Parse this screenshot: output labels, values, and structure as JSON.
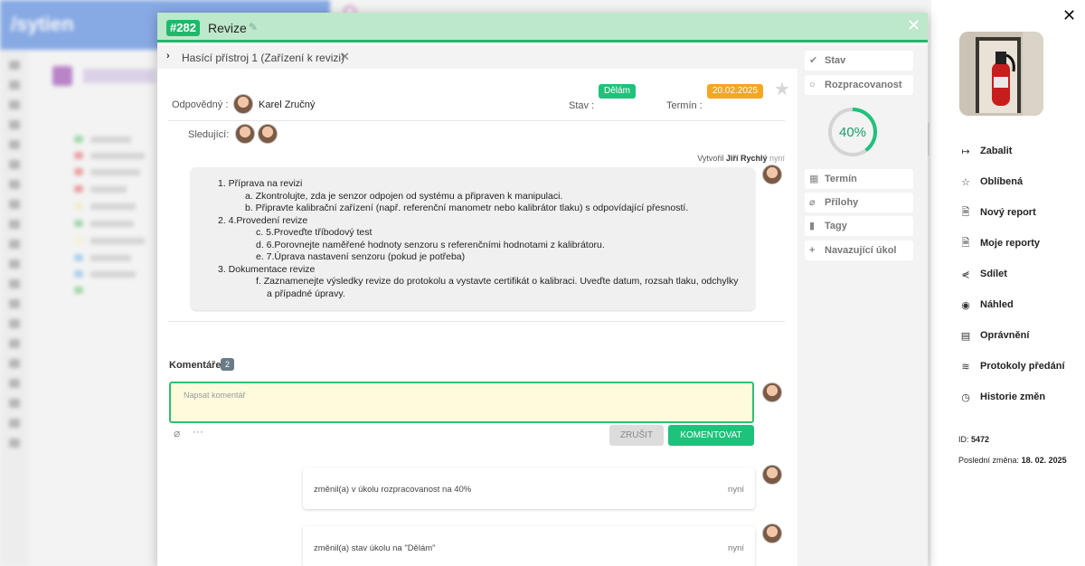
{
  "background": {
    "logo": "/sytien"
  },
  "modal": {
    "task_id": "#282",
    "title": "Revize",
    "breadcrumb": "Hasící přístroj 1 (Zařízení k revizi)",
    "responsible_label": "Odpovědný :",
    "responsible_name": "Karel Zručný",
    "status_label": "Stav :",
    "status_value": "Dělám",
    "deadline_label": "Termín :",
    "deadline_value": "20.02.2025",
    "followers_label": "Sledující:",
    "created_by_prefix": "Vytvořil",
    "created_by": "Jiří Rychlý",
    "created_when": "nyní",
    "description": [
      {
        "level": 1,
        "text": "1. Příprava na revizi"
      },
      {
        "level": 2,
        "text": "a. Zkontrolujte, zda je senzor odpojen od systému a připraven k manipulaci."
      },
      {
        "level": 2,
        "text": "b. Připravte kalibrační zařízení (např. referenční manometr nebo kalibrátor tlaku) s odpovídající přesností."
      },
      {
        "level": 1,
        "text": "2. 4.Provedení revize"
      },
      {
        "level": 3,
        "text": "c. 5.Proveďte tříbodový test"
      },
      {
        "level": 3,
        "text": "d. 6.Porovnejte naměřené hodnoty senzoru s referenčními hodnotami z kalibrátoru."
      },
      {
        "level": 3,
        "text": "e. 7.Úprava nastavení senzoru (pokud je potřeba)"
      },
      {
        "level": 1,
        "text": "3. Dokumentace revize"
      },
      {
        "level": 3,
        "text": "f. Zaznamenejte výsledky revize do protokolu a vystavte certifikát o kalibraci. Uveďte datum, rozsah tlaku, odchylky"
      },
      {
        "level": 4,
        "text": "a případné úpravy."
      }
    ],
    "comments_label": "Komentáře",
    "comments_count": "2",
    "comment_placeholder": "Napsat komentář",
    "cancel_label": "ZRUŠIT",
    "submit_label": "KOMENTOVAT",
    "activities": [
      {
        "text": "změnil(a) v úkolu rozpracovanost na 40%",
        "time": "nyní"
      },
      {
        "text": "změnil(a) stav úkolu na \"Dělám\"",
        "time": "nyní"
      }
    ],
    "sidebar": {
      "stav": "Stav",
      "rozpracovanost": "Rozpracovanost",
      "progress_text": "40%",
      "progress_value": 0.4,
      "termin": "Termín",
      "prilohy": "Přílohy",
      "tagy": "Tagy",
      "navazujici": "Navazující úkol"
    }
  },
  "right_panel": {
    "menu": [
      {
        "label": "Zabalit",
        "icon": "collapse-icon"
      },
      {
        "label": "Oblíbená",
        "icon": "star-icon"
      },
      {
        "label": "Nový report",
        "icon": "new-report-icon"
      },
      {
        "label": "Moje reporty",
        "icon": "reports-icon"
      },
      {
        "label": "Sdílet",
        "icon": "share-icon"
      },
      {
        "label": "Náhled",
        "icon": "eye-icon"
      },
      {
        "label": "Oprávnění",
        "icon": "permissions-icon"
      },
      {
        "label": "Protokoly předání",
        "icon": "handover-icon"
      },
      {
        "label": "Historie změn",
        "icon": "history-icon"
      }
    ],
    "id_label": "ID:",
    "id_value": "5472",
    "last_change_label": "Poslední změna:",
    "last_change_value": "18. 02. 2025"
  },
  "colors": {
    "accent_green": "#1fc27a",
    "deadline_orange": "#f5a623",
    "header_green": "#bde8cb"
  }
}
